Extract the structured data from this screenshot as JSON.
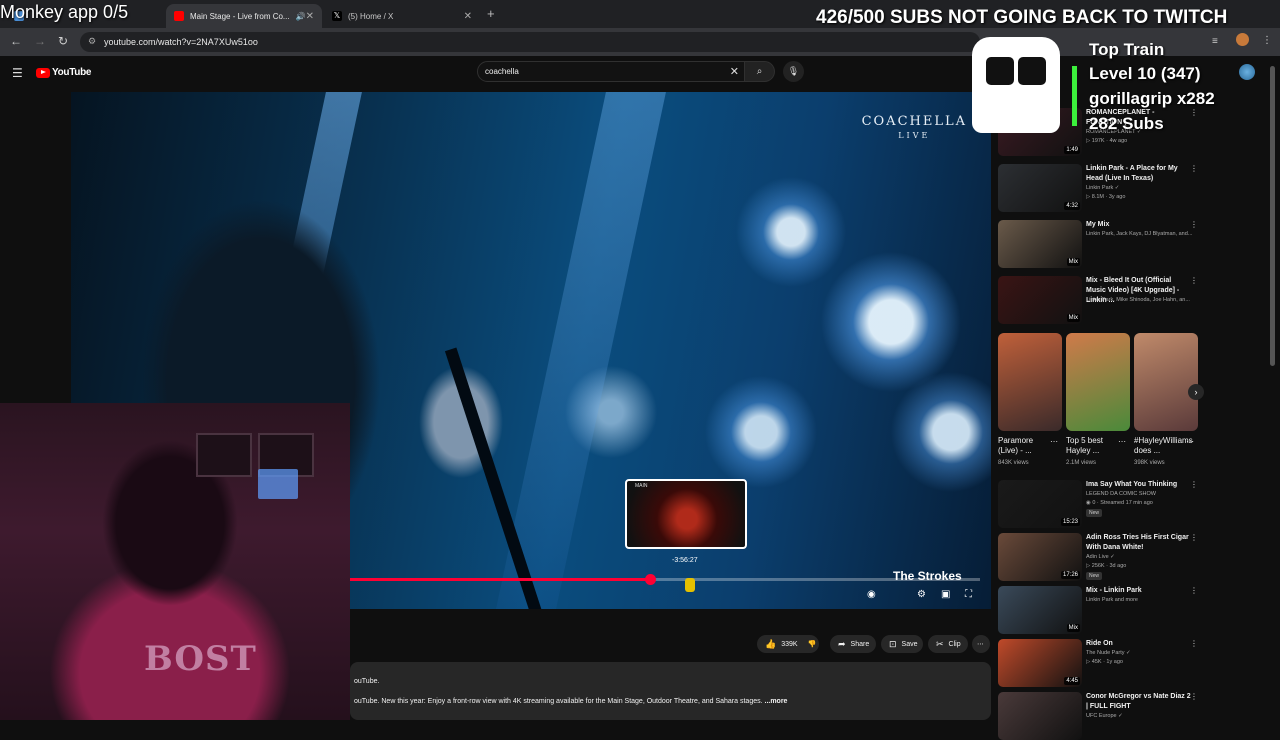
{
  "browser": {
    "tabs": [
      {
        "label": "",
        "active": false,
        "color": "#4a90d9"
      },
      {
        "label": "Main Stage - Live from Co...",
        "active": true,
        "color": "#ff0000"
      },
      {
        "label": "(5) Home / X",
        "active": false,
        "color": "#000000"
      }
    ],
    "url": "youtube.com/watch?v=2NA7XUw51oo"
  },
  "youtube": {
    "logo_text": "YouTube",
    "search_value": "coachella"
  },
  "video": {
    "watermark": "COACHELLA",
    "watermark_sub": "LIVE",
    "artist_overlay": "The Strokes",
    "preview_tag": "MAIN",
    "hover_time": "-3:56:27",
    "progress_fraction": 0.476
  },
  "actions": {
    "likes": "339K",
    "share": "Share",
    "save": "Save",
    "clip": "Clip"
  },
  "description": {
    "line1": "ouTube.",
    "line2": "ouTube. New this year: Enjoy a front-row view with 4K streaming available for the Main Stage, Outdoor Theatre, and Sahara stages. ",
    "more": "...more"
  },
  "overlay": {
    "monkey": "Monkey app 0/5",
    "subs_goal": "426/500 SUBS NOT GOING BACK TO TWITCH",
    "train_title": "Top Train",
    "train_level": "Level 10 (347)",
    "train_user": "gorillagrip x282",
    "train_subs": "282 Subs"
  },
  "sidebar": {
    "recos": [
      {
        "title": "ROMANCEPLANET - FUNCTION (...",
        "channel": "ROMANCEPLANET ✓",
        "meta": "▷ 197K · 4w ago",
        "dur": "1:49",
        "thumb": "#3a1a22"
      },
      {
        "title": "Linkin Park - A Place for My Head (Live In Texas)",
        "channel": "Linkin Park ✓",
        "meta": "▷ 8.1M · 3y ago",
        "dur": "4:32",
        "thumb": "#2c2f33"
      },
      {
        "title": "My Mix",
        "channel": "Linkin Park, Jack Kays, DJ Blyatman, and...",
        "meta": "",
        "dur": "Mix",
        "thumb": "#6a5a4a"
      },
      {
        "title": "Mix - Bleed It Out (Official Music Video) [4K Upgrade] - Linkin ...",
        "channel": "Linkin Park, Mike Shinoda, Joe Hahn, an...",
        "meta": "",
        "dur": "Mix",
        "thumb": "#3a1414"
      }
    ],
    "shorts": [
      {
        "title": "Paramore (Live) - ...",
        "views": "843K views",
        "color": "#8a4a3a"
      },
      {
        "title": "Top 5 best Hayley ...",
        "views": "2.1M views",
        "color": "#4a7a3a"
      },
      {
        "title": "#HayleyWilliams does ...",
        "views": "398K views",
        "color": "#7a5a4a"
      }
    ],
    "recos2": [
      {
        "title": "Ima Say What You Thinking",
        "channel": "LEGEND DA COMIC SHOW",
        "meta": "◉ 0 · Streamed 17 min ago",
        "badge": "New",
        "dur": "15:23",
        "thumb": "#1a1a1a"
      },
      {
        "title": "Adin Ross Tries His First Cigar With Dana White!",
        "channel": "Adin Live ✓",
        "meta": "▷ 256K · 3d ago",
        "badge": "New",
        "dur": "17:26",
        "thumb": "#6a4a3a"
      },
      {
        "title": "Mix - Linkin Park",
        "channel": "Linkin Park and more",
        "meta": "",
        "badge": "",
        "dur": "Mix",
        "thumb": "#3a4a5a"
      },
      {
        "title": "Ride On",
        "channel": "The Nude Party ✓",
        "meta": "▷ 45K · 1y ago",
        "badge": "",
        "dur": "4:45",
        "thumb": "#c04a2a"
      },
      {
        "title": "Conor McGregor vs Nate Diaz 2 | FULL FIGHT",
        "channel": "UFC Europe ✓",
        "meta": "",
        "badge": "",
        "dur": "",
        "thumb": "#4a3a3a"
      }
    ]
  }
}
